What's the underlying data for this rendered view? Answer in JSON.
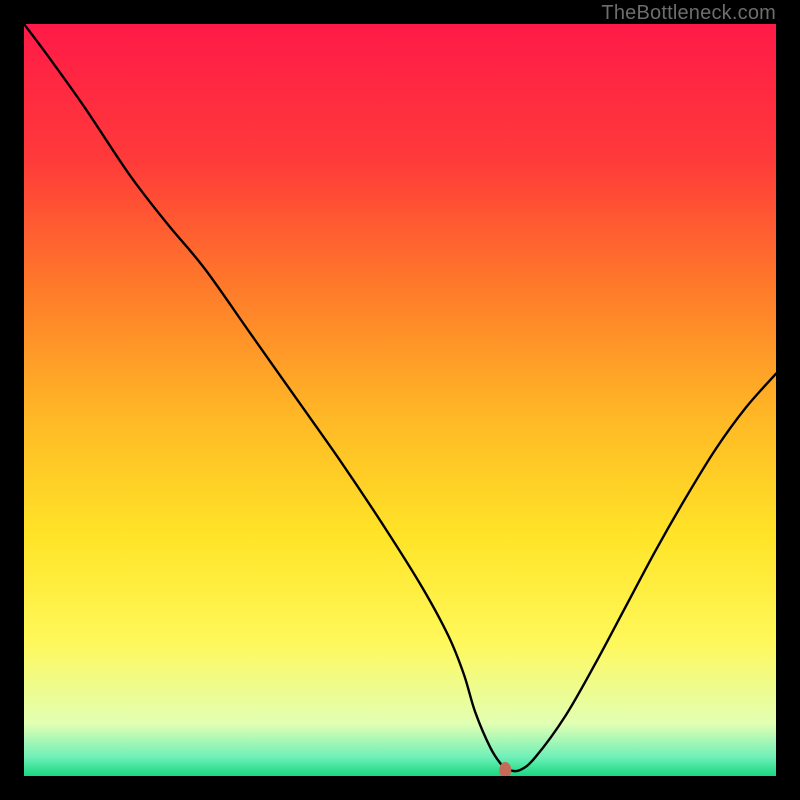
{
  "watermark": "TheBottleneck.com",
  "chart_data": {
    "type": "line",
    "title": "",
    "xlabel": "",
    "ylabel": "",
    "xlim": [
      0,
      100
    ],
    "ylim": [
      0,
      100
    ],
    "grid": false,
    "legend": false,
    "gradient_stops": [
      {
        "offset": 0.0,
        "color": "#ff1a48"
      },
      {
        "offset": 0.18,
        "color": "#ff3a3a"
      },
      {
        "offset": 0.35,
        "color": "#ff7a2a"
      },
      {
        "offset": 0.52,
        "color": "#ffb726"
      },
      {
        "offset": 0.68,
        "color": "#ffe427"
      },
      {
        "offset": 0.82,
        "color": "#fff85a"
      },
      {
        "offset": 0.93,
        "color": "#e2ffb3"
      },
      {
        "offset": 0.975,
        "color": "#6ef0b8"
      },
      {
        "offset": 1.0,
        "color": "#18d77f"
      }
    ],
    "series": [
      {
        "name": "bottleneck-curve",
        "x": [
          0.0,
          3.0,
          8.0,
          14.0,
          19.0,
          24.0,
          30.0,
          36.0,
          42.0,
          48.0,
          53.0,
          56.5,
          58.5,
          60.0,
          62.0,
          63.5,
          64.5,
          66.0,
          68.0,
          72.0,
          76.0,
          80.0,
          84.0,
          88.0,
          92.0,
          96.0,
          100.0
        ],
        "y": [
          100.0,
          96.0,
          89.0,
          80.0,
          73.5,
          67.5,
          59.0,
          50.5,
          42.0,
          33.0,
          25.0,
          18.5,
          13.5,
          8.5,
          3.8,
          1.5,
          0.8,
          0.8,
          2.5,
          8.0,
          15.0,
          22.5,
          30.0,
          37.0,
          43.5,
          49.0,
          53.5
        ]
      }
    ],
    "annotations": [
      {
        "name": "min-marker",
        "x": 64.0,
        "y": 0.8,
        "color": "#c56b58",
        "rx": 6,
        "ry": 8
      }
    ]
  }
}
